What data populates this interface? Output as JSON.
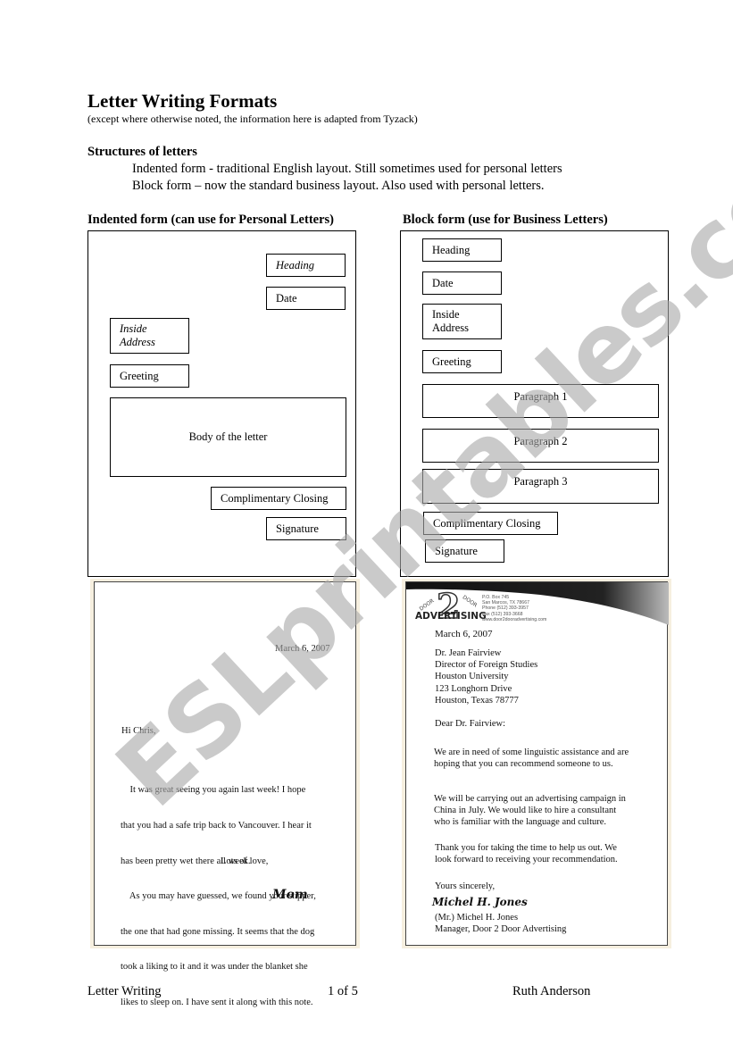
{
  "header": {
    "title": "Letter Writing Formats",
    "subtitle": "(except where otherwise noted, the information here is adapted from Tyzack)"
  },
  "structures": {
    "heading": "Structures of letters",
    "lines": [
      "Indented form - traditional English layout. Still sometimes used for personal letters",
      "Block form – now the standard business layout. Also used with personal letters."
    ]
  },
  "indented_form": {
    "title": "Indented form (can use for Personal Letters)",
    "boxes": {
      "heading": "Heading",
      "date": "Date",
      "inside_address_1": "Inside",
      "inside_address_2": "Address",
      "greeting": "Greeting",
      "body": "Body of the letter",
      "closing": "Complimentary Closing",
      "signature": "Signature"
    }
  },
  "block_form": {
    "title": "Block form (use for Business Letters)",
    "boxes": {
      "heading": "Heading",
      "date": "Date",
      "inside_address_1": "Inside",
      "inside_address_2": "Address",
      "greeting": "Greeting",
      "paragraph_1": "Paragraph 1",
      "paragraph_2": "Paragraph 2",
      "paragraph_3": "Paragraph 3",
      "closing": "Complimentary Closing",
      "signature": "Signature"
    }
  },
  "personal_letter": {
    "date": "March  6, 2007",
    "greeting": "Hi Chris,",
    "body_lines": [
      "    It was great seeing you again last week! I hope",
      "that you had a safe trip back to Vancouver. I hear it",
      "has been pretty wet there all week.",
      "    As you may have guessed, we found your slipper,",
      "the one that had gone missing. It seems that the dog",
      "took a liking to it and it was under the blanket she",
      "likes to sleep on. I have sent it along with this note."
    ],
    "closing": "Lots of  love,",
    "signature": "Mom"
  },
  "business_letter": {
    "letterhead": {
      "logo_number": "2",
      "logo_arc_left": "DOOR",
      "logo_arc_right": "DOOR",
      "logo_word": "ADVERTISING",
      "contact_lines": [
        "P.O. Box 745",
        "San Marcos, TX 78667",
        "Phone (512) 393-3957",
        "Fax (512) 393-3668",
        "www.door2dooradvertising.com"
      ]
    },
    "date": "March 6, 2007",
    "inside_address": [
      "Dr. Jean Fairview",
      "Director of Foreign Studies",
      "Houston University",
      "123 Longhorn Drive",
      "Houston, Texas  78777"
    ],
    "salutation": "Dear Dr. Fairview:",
    "paragraph_1": [
      "We are in need of some linguistic assistance and are",
      "hoping that you can recommend someone to us."
    ],
    "paragraph_2": [
      "We will be carrying out an advertising campaign in",
      "China in July. We would like to hire a consultant",
      "who is familiar with the language and culture."
    ],
    "paragraph_3": [
      "Thank you for taking the time to help us out.  We",
      "look forward to receiving your recommendation."
    ],
    "closing": "Yours sincerely,",
    "signature": "Michel H. Jones",
    "signer_name": "(Mr.) Michel H. Jones",
    "signer_title": "Manager, Door 2 Door Advertising"
  },
  "watermark": "ESLprintables.com",
  "footer": {
    "left": "Letter Writing",
    "center": "1 of 5",
    "right": "Ruth Anderson"
  }
}
